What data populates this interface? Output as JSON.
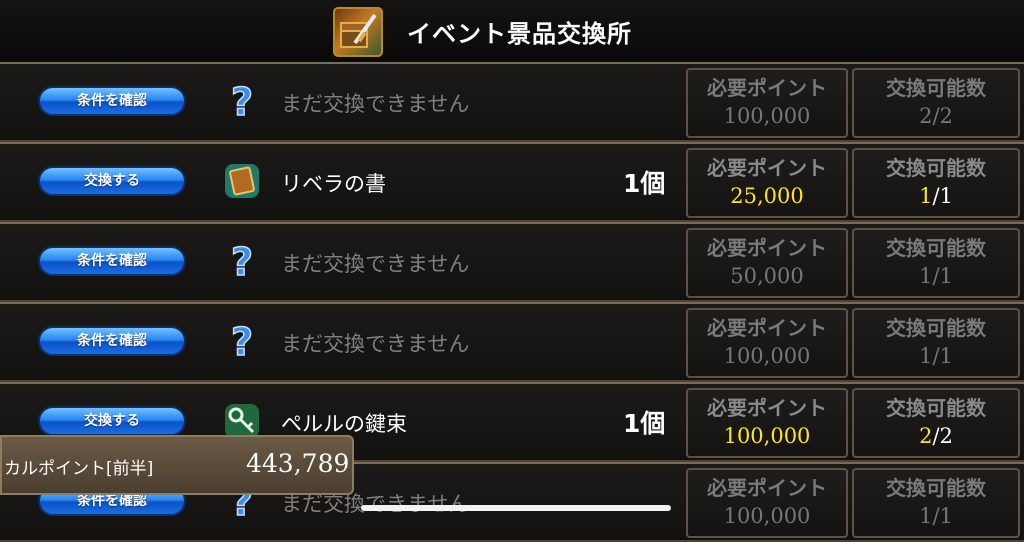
{
  "header": {
    "title": "イベント景品交換所",
    "icon": "treasure-chest-sword-icon"
  },
  "columns": {
    "points_label": "必要ポイント",
    "count_label": "交換可能数"
  },
  "rows": [
    {
      "button": "条件を確認",
      "icon": "question-icon",
      "name": "まだ交換できません",
      "qty": "",
      "points": "100,000",
      "count_have": "2",
      "count_total": "/2",
      "available": false
    },
    {
      "button": "交換する",
      "icon": "book-icon",
      "name": "リベラの書",
      "qty": "1個",
      "points": "25,000",
      "count_have": "1",
      "count_total": "/1",
      "available": true
    },
    {
      "button": "条件を確認",
      "icon": "question-icon",
      "name": "まだ交換できません",
      "qty": "",
      "points": "50,000",
      "count_have": "1",
      "count_total": "/1",
      "available": false
    },
    {
      "button": "条件を確認",
      "icon": "question-icon",
      "name": "まだ交換できません",
      "qty": "",
      "points": "100,000",
      "count_have": "1",
      "count_total": "/1",
      "available": false
    },
    {
      "button": "交換する",
      "icon": "key-bundle-icon",
      "name": "ペルルの鍵束",
      "qty": "1個",
      "points": "100,000",
      "count_have": "2",
      "count_total": "/2",
      "available": true
    },
    {
      "button": "条件を確認",
      "icon": "question-icon",
      "name": "まだ交換できません",
      "qty": "",
      "points": "100,000",
      "count_have": "1",
      "count_total": "/1",
      "available": false
    }
  ],
  "total": {
    "label": "カルポイント[前半]",
    "value": "443,789"
  },
  "colors": {
    "highlight": "#ffe51a",
    "button_blue": "#2a86f0",
    "frame": "#7a6c58"
  }
}
